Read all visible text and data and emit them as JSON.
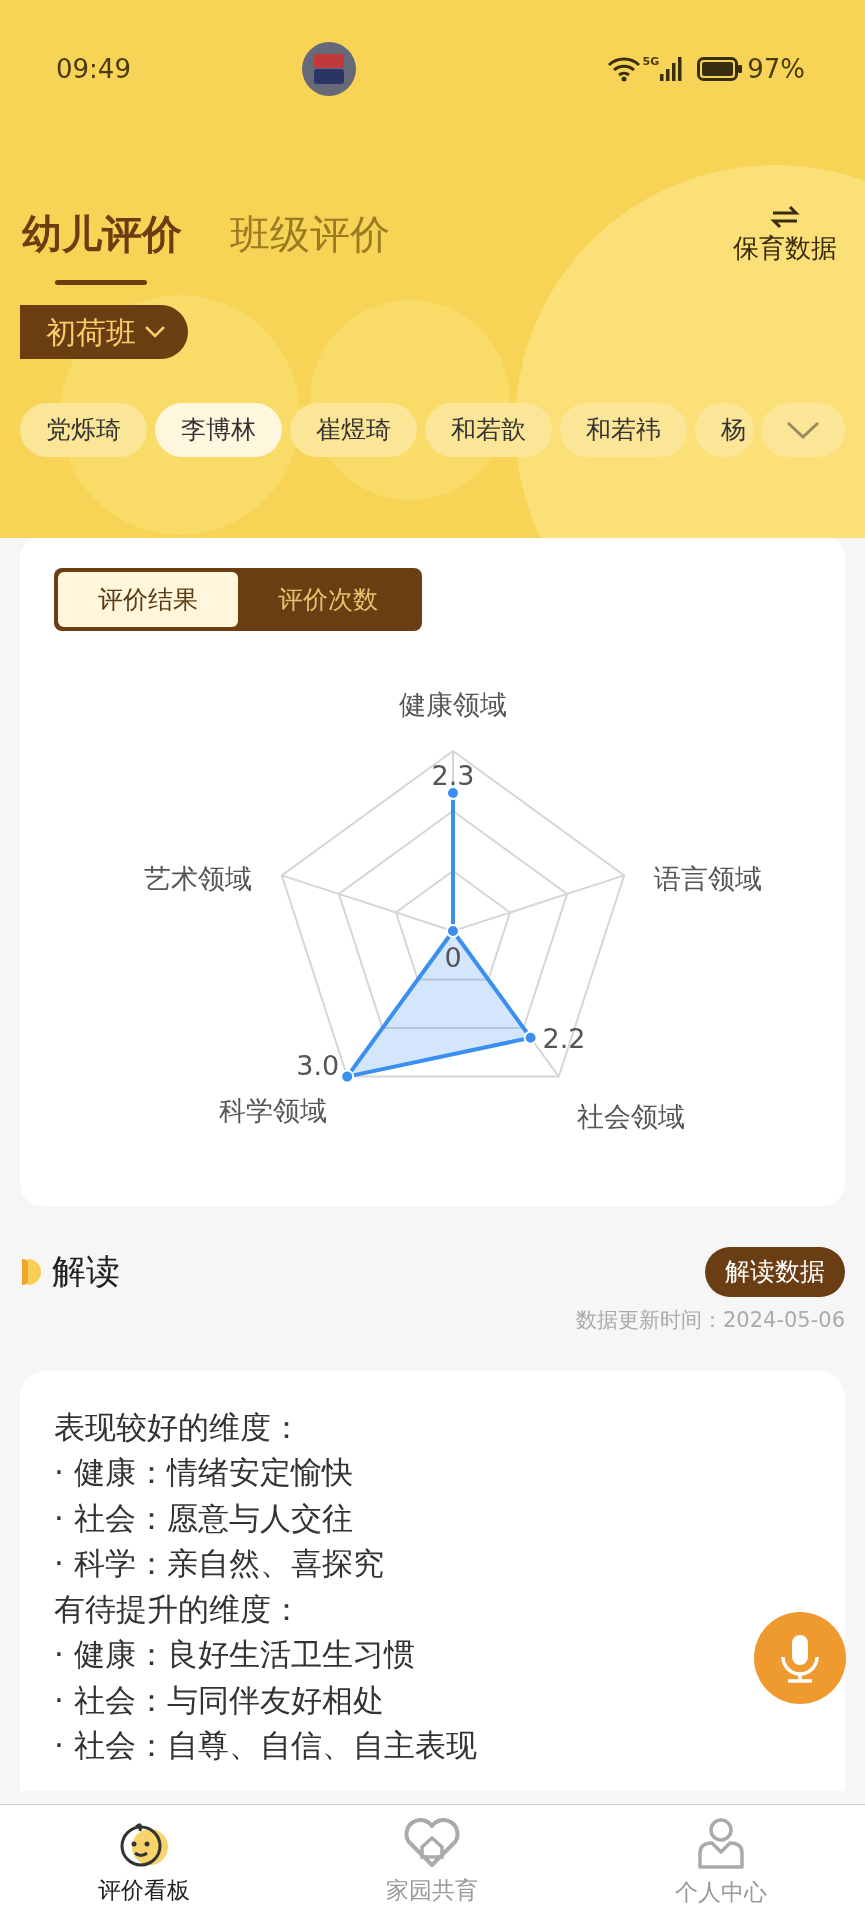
{
  "status_bar": {
    "time": "09:49",
    "network": "5G",
    "battery": "97%"
  },
  "header": {
    "tabs": [
      {
        "label": "幼儿评价",
        "selected": true
      },
      {
        "label": "班级评价",
        "selected": false
      }
    ],
    "action": "保育数据",
    "class_picker": "初荷班"
  },
  "children": [
    {
      "name": "党烁琦",
      "selected": false
    },
    {
      "name": "李博林",
      "selected": true
    },
    {
      "name": "崔煜琦",
      "selected": false
    },
    {
      "name": "和若歆",
      "selected": false
    },
    {
      "name": "和若祎",
      "selected": false
    },
    {
      "name": "杨",
      "selected": false
    }
  ],
  "result_card": {
    "segments": [
      {
        "label": "评价结果",
        "selected": true
      },
      {
        "label": "评价次数",
        "selected": false
      }
    ],
    "radar": {
      "center_label": "0",
      "axes": [
        {
          "label": "健康领域",
          "value": "2.3"
        },
        {
          "label": "艺术领域"
        },
        {
          "label": "语言领域"
        },
        {
          "label": "科学领域",
          "value": "3.0"
        },
        {
          "label": "社会领域",
          "value": "2.2"
        }
      ]
    }
  },
  "interpretation": {
    "title": "解读",
    "button": "解读数据",
    "updated_label": "数据更新时间：",
    "updated": "2024-05-06",
    "lines": [
      "表现较好的维度：",
      "· 健康：情绪安定愉快",
      "· 社会：愿意与人交往",
      "· 科学：亲自然、喜探究",
      "有待提升的维度：",
      "· 健康：良好生活卫生习惯",
      "· 社会：与同伴友好相处",
      "· 社会：自尊、自信、自主表现"
    ]
  },
  "bottom_nav": [
    {
      "label": "评价看板",
      "selected": true
    },
    {
      "label": "家园共育",
      "selected": false
    },
    {
      "label": "个人中心",
      "selected": false
    }
  ]
}
